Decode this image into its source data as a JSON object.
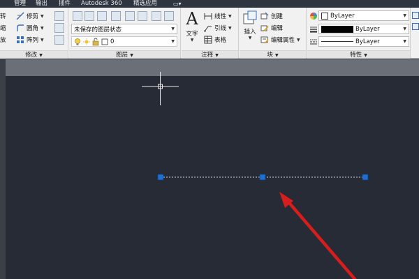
{
  "menu": {
    "tabs": [
      "管理",
      "输出",
      "插件",
      "Autodesk 360",
      "精选应用"
    ]
  },
  "ribbon": {
    "modify": {
      "title": "修改",
      "items": [
        {
          "label": "修剪",
          "icon": "trim-icon"
        },
        {
          "label": "圆角",
          "icon": "fillet-icon"
        },
        {
          "label": "阵列",
          "icon": "array-icon"
        }
      ],
      "left_labels": [
        "转",
        "缩",
        "放"
      ]
    },
    "layers": {
      "title": "图层",
      "layer_state": "未保存的图层状态",
      "current_layer": "0"
    },
    "annotation": {
      "title": "注释",
      "text_label": "文字",
      "items": [
        "线性",
        "引线",
        "表格"
      ]
    },
    "block": {
      "title": "块",
      "insert_label": "插入",
      "items": [
        "创建",
        "编辑",
        "编辑属性"
      ]
    },
    "properties": {
      "title": "特性",
      "color": "ByLayer",
      "linetype": "ByLayer",
      "lineweight": "ByLayer"
    }
  },
  "colors": {
    "canvas": "#262b35",
    "grip": "#1f6fd0",
    "arrow": "#d81d1d",
    "crosshair": "#e8e8e8"
  }
}
